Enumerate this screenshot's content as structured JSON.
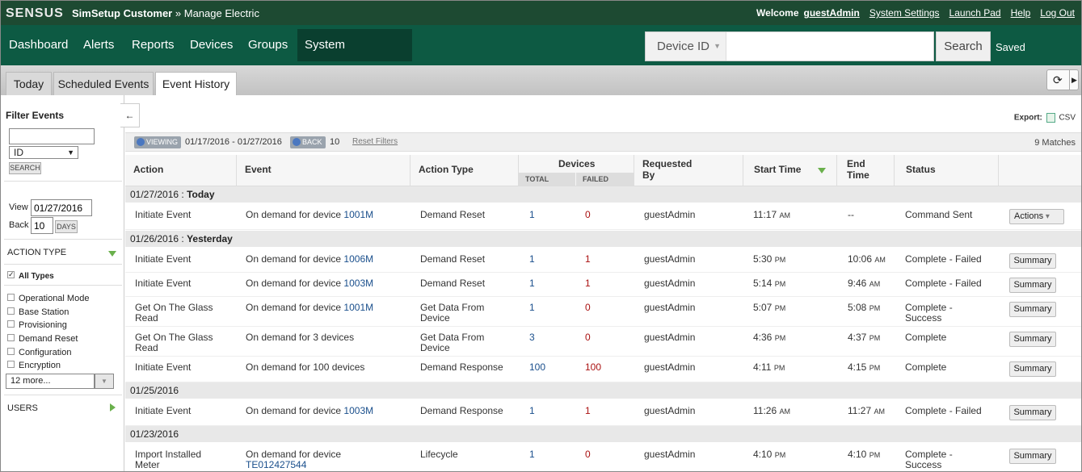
{
  "topbar": {
    "logo": "SENSUS",
    "customer": "SimSetup Customer",
    "separator": "»",
    "page": "Manage Electric",
    "welcome": "Welcome",
    "username": "guestAdmin",
    "links": [
      "System Settings",
      "Launch Pad",
      "Help",
      "Log Out"
    ]
  },
  "nav": {
    "items": [
      "Dashboard",
      "Alerts",
      "Reports",
      "Devices",
      "Groups",
      "System Intelligence"
    ],
    "selected": "System Intelligence",
    "search_type": "Device ID",
    "search_value": "",
    "search_button": "Search",
    "saved": "Saved"
  },
  "tabs": [
    "Today",
    "Scheduled Events",
    "Event History"
  ],
  "active_tab": "Event History",
  "sidebar": {
    "title": "Filter Events",
    "filter_input": "",
    "filter_type": "ID",
    "search_button": "SEARCH",
    "view_label": "View",
    "view_date": "01/27/2016",
    "back_label": "Back",
    "back_value": "10",
    "days_button": "DAYS",
    "action_type_header": "ACTION TYPE",
    "all_types": "All Types",
    "types": [
      "Operational Mode",
      "Base Station",
      "Provisioning",
      "Demand Reset",
      "Configuration",
      "Encryption"
    ],
    "more": "12 more...",
    "users_header": "USERS"
  },
  "main": {
    "export_label": "Export:",
    "export_format": "CSV",
    "viewing_pill": "VIEWING",
    "date_range": "01/17/2016 - 01/27/2016",
    "back_pill": "BACK",
    "back_value": "10",
    "reset_filters": "Reset Filters",
    "matches": "9 Matches"
  },
  "table": {
    "headers": {
      "action": "Action",
      "event": "Event",
      "action_type": "Action Type",
      "devices": "Devices",
      "total": "TOTAL",
      "failed": "FAILED",
      "requested_by_1": "Requested",
      "requested_by_2": "By",
      "start_time": "Start Time",
      "end_time_1": "End",
      "end_time_2": "Time",
      "status": "Status"
    },
    "groups": [
      {
        "date": "01/27/2016",
        "label": "Today"
      },
      {
        "date": "01/26/2016",
        "label": "Yesterday"
      },
      {
        "date": "01/25/2016",
        "label": ""
      },
      {
        "date": "01/23/2016",
        "label": ""
      }
    ],
    "rows": [
      {
        "action": "Initiate Event",
        "action2": "",
        "event": "On demand for device",
        "device": "1001M",
        "action_type": "Demand Reset",
        "action_type2": "",
        "total": "1",
        "failed": "0",
        "requested_by": "guestAdmin",
        "start": "11:17",
        "start_ampm": "AM",
        "end": "--",
        "end_ampm": "",
        "status": "Command Sent",
        "status2": "",
        "button": "Actions"
      },
      {
        "action": "Initiate Event",
        "action2": "",
        "event": "On demand for device",
        "device": "1006M",
        "action_type": "Demand Reset",
        "action_type2": "",
        "total": "1",
        "failed": "1",
        "requested_by": "guestAdmin",
        "start": "5:30",
        "start_ampm": "PM",
        "end": "10:06",
        "end_ampm": "AM",
        "status": "Complete - Failed",
        "status2": "",
        "button": "Summary"
      },
      {
        "action": "Initiate Event",
        "action2": "",
        "event": "On demand for device",
        "device": "1003M",
        "action_type": "Demand Reset",
        "action_type2": "",
        "total": "1",
        "failed": "1",
        "requested_by": "guestAdmin",
        "start": "5:14",
        "start_ampm": "PM",
        "end": "9:46",
        "end_ampm": "AM",
        "status": "Complete - Failed",
        "status2": "",
        "button": "Summary"
      },
      {
        "action": "Get On The Glass",
        "action2": "Read",
        "event": "On demand for device",
        "device": "1001M",
        "action_type": "Get Data From",
        "action_type2": "Device",
        "total": "1",
        "failed": "0",
        "requested_by": "guestAdmin",
        "start": "5:07",
        "start_ampm": "PM",
        "end": "5:08",
        "end_ampm": "PM",
        "status": "Complete -",
        "status2": "Success",
        "button": "Summary"
      },
      {
        "action": "Get On The Glass",
        "action2": "Read",
        "event": "On demand for 3 devices",
        "device": "",
        "action_type": "Get Data From",
        "action_type2": "Device",
        "total": "3",
        "failed": "0",
        "requested_by": "guestAdmin",
        "start": "4:36",
        "start_ampm": "PM",
        "end": "4:37",
        "end_ampm": "PM",
        "status": "Complete",
        "status2": "",
        "button": "Summary"
      },
      {
        "action": "Initiate Event",
        "action2": "",
        "event": "On demand for 100 devices",
        "device": "",
        "action_type": "Demand Response",
        "action_type2": "",
        "total": "100",
        "failed": "100",
        "requested_by": "guestAdmin",
        "start": "4:11",
        "start_ampm": "PM",
        "end": "4:15",
        "end_ampm": "PM",
        "status": "Complete",
        "status2": "",
        "button": "Summary"
      },
      {
        "action": "Initiate Event",
        "action2": "",
        "event": "On demand for device",
        "device": "1003M",
        "action_type": "Demand Response",
        "action_type2": "",
        "total": "1",
        "failed": "1",
        "requested_by": "guestAdmin",
        "start": "11:26",
        "start_ampm": "AM",
        "end": "11:27",
        "end_ampm": "AM",
        "status": "Complete - Failed",
        "status2": "",
        "button": "Summary"
      },
      {
        "action": "Import Installed",
        "action2": "Meter",
        "event": "On demand for device",
        "device": "TE012427544",
        "action_type": "Lifecycle",
        "action_type2": "",
        "total": "1",
        "failed": "0",
        "requested_by": "guestAdmin",
        "start": "4:10",
        "start_ampm": "PM",
        "end": "4:10",
        "end_ampm": "PM",
        "status": "Complete -",
        "status2": "Success",
        "button": "Summary"
      }
    ]
  }
}
